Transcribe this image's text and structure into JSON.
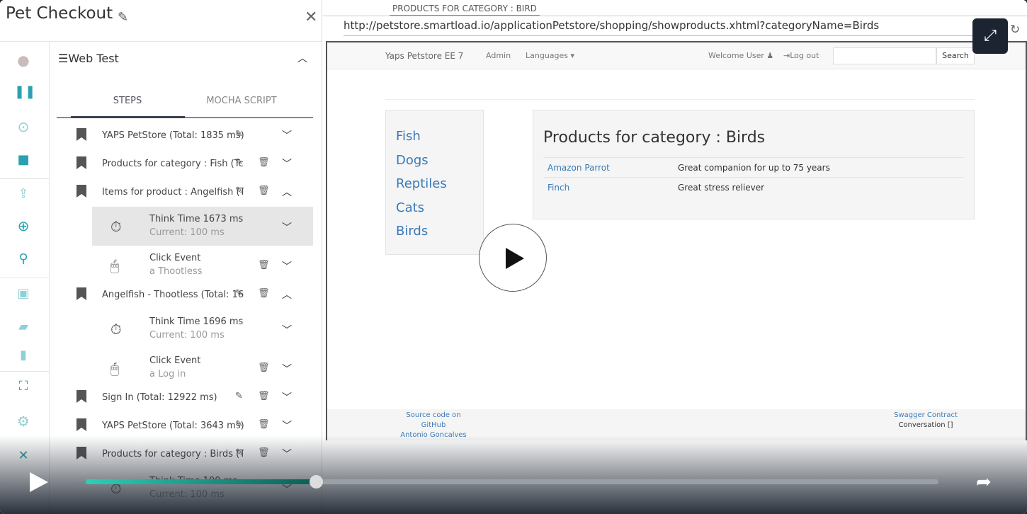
{
  "panel": {
    "title": "Pet Checkout",
    "section": "Web Test",
    "tabs": [
      "STEPS",
      "MOCHA SCRIPT"
    ]
  },
  "steps": [
    {
      "label": "YAPS PetStore (Total: 1835 ms)",
      "expanded": false
    },
    {
      "label": "Products for category : Fish (Tc",
      "expanded": false
    },
    {
      "label": "Items for product : Angelfish (T",
      "expanded": true
    },
    {
      "sub": true,
      "l1": "Think Time 1673 ms",
      "l2": "Current: 100 ms",
      "icon": "timer-icon"
    },
    {
      "sub": true,
      "l1": "Click Event",
      "l2": "a Thootless",
      "icon": "mouse-icon"
    },
    {
      "label": "Angelfish - Thootless (Total: 16",
      "expanded": true
    },
    {
      "sub": true,
      "l1": "Think Time 1696 ms",
      "l2": "Current: 100 ms",
      "icon": "timer-icon"
    },
    {
      "sub": true,
      "l1": "Click Event",
      "l2": "a Log in",
      "icon": "mouse-icon"
    },
    {
      "label": "Sign In (Total: 12922 ms)",
      "expanded": false
    },
    {
      "label": "YAPS PetStore (Total: 3643 ms)",
      "expanded": false
    },
    {
      "label": "Products for category : Birds (T",
      "expanded": false
    },
    {
      "sub": true,
      "l1": "Think Time 100 ms",
      "l2": "Current: 100 ms",
      "icon": "timer-icon"
    }
  ],
  "browser": {
    "tab": "PRODUCTS FOR CATEGORY : BIRD",
    "url": "http://petstore.smartload.io/applicationPetstore/shopping/showproducts.xhtml?categoryName=Birds"
  },
  "site": {
    "brand": "Yaps Petstore EE 7",
    "admin": "Admin",
    "languages": "Languages ▾",
    "welcome": "Welcome User ♟",
    "logout": "⇥Log out",
    "search": "Search",
    "categories": [
      "Fish",
      "Dogs",
      "Reptiles",
      "Cats",
      "Birds"
    ],
    "heading": "Products for category : Birds",
    "products": [
      {
        "name": "Amazon Parrot",
        "desc": "Great companion for up to 75 years"
      },
      {
        "name": "Finch",
        "desc": "Great stress reliever"
      }
    ],
    "footer": {
      "source1": "Source code on",
      "source2": "GitHub",
      "source3": "Antonio Goncalves",
      "swagger": "Swagger Contract",
      "conv": "Conversation []"
    }
  },
  "video": {
    "progress": 0.27
  }
}
